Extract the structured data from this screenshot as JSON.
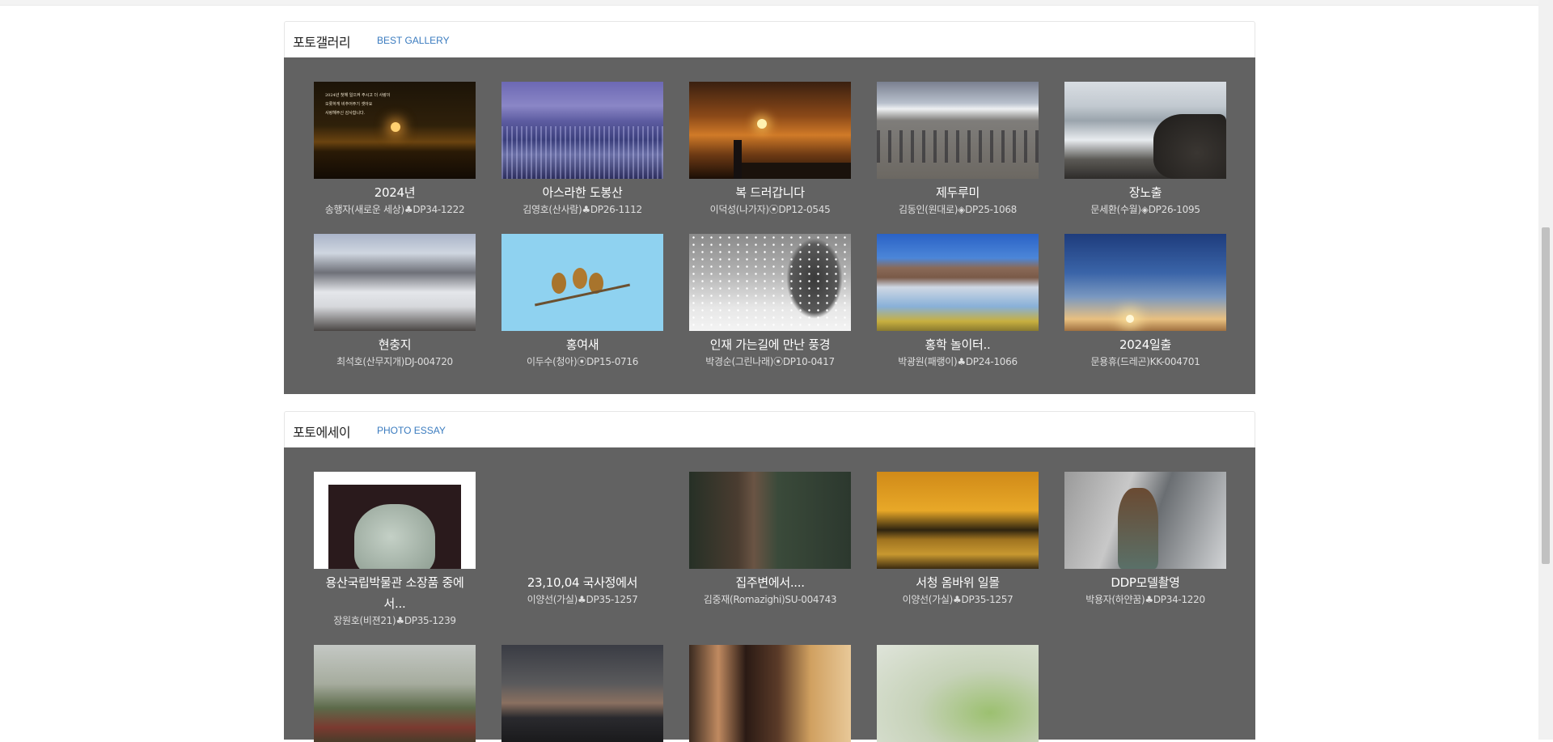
{
  "gallery": {
    "title": "포토갤러리",
    "subtitle": "BEST GALLERY",
    "items": [
      {
        "caption": "2024년",
        "meta": "송행자(새로운 세상)♣DP34-1222",
        "overlay": "2024년 첫해 일으켜 주시고 더 사랑이\n오롯하게 비추어주기 셋아요\n사랑해주신 감사합니다.",
        "icon": "sunset-text-photo"
      },
      {
        "caption": "아스라한 도봉산",
        "meta": "김영호(산사람)♣DP26-1112",
        "icon": "city-night-photo"
      },
      {
        "caption": "복 드러갑니다",
        "meta": "이덕성(나가자)⦿DP12-0545",
        "icon": "lighthouse-sunrise-photo"
      },
      {
        "caption": "제두루미",
        "meta": "김동인(원대로)◈DP25-1068",
        "icon": "cranes-photo"
      },
      {
        "caption": "장노출",
        "meta": "문세환(수월)◈DP26-1095",
        "icon": "seascape-photo"
      },
      {
        "caption": "현충지",
        "meta": "최석호(산무지개)DJ-004720",
        "icon": "snow-pond-photo"
      },
      {
        "caption": "홍여새",
        "meta": "이두수(청아)⦿DP15-0716",
        "icon": "birds-branch-photo"
      },
      {
        "caption": "인재 가는길에 만난 풍경",
        "meta": "박경순(그린나래)⦿DP10-0417",
        "icon": "snowfall-photo"
      },
      {
        "caption": "홍학 놀이터..",
        "meta": "박광원(패랭이)♣DP24-1066",
        "icon": "flamingo-lake-photo"
      },
      {
        "caption": "2024일출",
        "meta": "문용휴(드레곤)KK-004701",
        "icon": "sunrise-sky-photo"
      }
    ]
  },
  "essay": {
    "title": "포토에세이",
    "subtitle": "PHOTO ESSAY",
    "items": [
      {
        "caption": "용산국립박물관 소장품 중에 서...",
        "meta": "장원호(비젼21)♣DP35-1239",
        "icon": "celadon-jar-photo"
      },
      {
        "caption": "23,10,04 국사정에서",
        "meta": "이양선(가실)♣DP35-1257",
        "icon": "empty-photo"
      },
      {
        "caption": "집주변에서....",
        "meta": "김중재(Romazighi)SU-004743",
        "icon": "forest-photo"
      },
      {
        "caption": "서청 옴바위 일몰",
        "meta": "이양선(가실)♣DP35-1257",
        "icon": "sea-sunset-photo"
      },
      {
        "caption": "DDP모델촬영",
        "meta": "박용자(하얀꿈)♣DP34-1220",
        "icon": "model-photo"
      },
      {
        "caption": "",
        "meta": "",
        "icon": "foggy-field-photo"
      },
      {
        "caption": "",
        "meta": "",
        "icon": "dusk-sky-photo"
      },
      {
        "caption": "",
        "meta": "",
        "icon": "women-portrait-photo"
      },
      {
        "caption": "",
        "meta": "",
        "icon": "grass-photo"
      }
    ]
  },
  "colors": {
    "panel": "#626262",
    "link": "#3a7bbf"
  }
}
